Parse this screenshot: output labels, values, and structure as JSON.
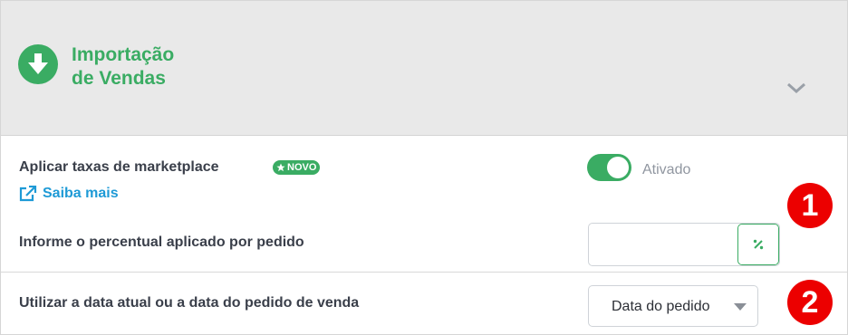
{
  "header": {
    "icon": "download-arrow-icon",
    "title_line1": "Importação",
    "title_line2": "de Vendas",
    "accent_color": "#3aac63",
    "collapse_icon": "chevron-down-icon"
  },
  "marketplace_fees": {
    "label": "Aplicar taxas de marketplace",
    "badge": "NOVO",
    "badge_icon": "star-icon",
    "learn_more": "Saiba mais",
    "learn_more_icon": "external-link-icon",
    "toggle_state": "on",
    "toggle_label": "Ativado"
  },
  "percentage": {
    "label": "Informe o percentual aplicado por pedido",
    "value": "",
    "addon_icon": "percent-icon",
    "addon_text": "%"
  },
  "date_option": {
    "label": "Utilizar a data atual ou a data do pedido de venda",
    "selected": "Data do pedido"
  },
  "markers": [
    "1",
    "2"
  ],
  "colors": {
    "accent": "#3aac63",
    "link": "#1e9ad6",
    "marker": "#ec0000"
  }
}
